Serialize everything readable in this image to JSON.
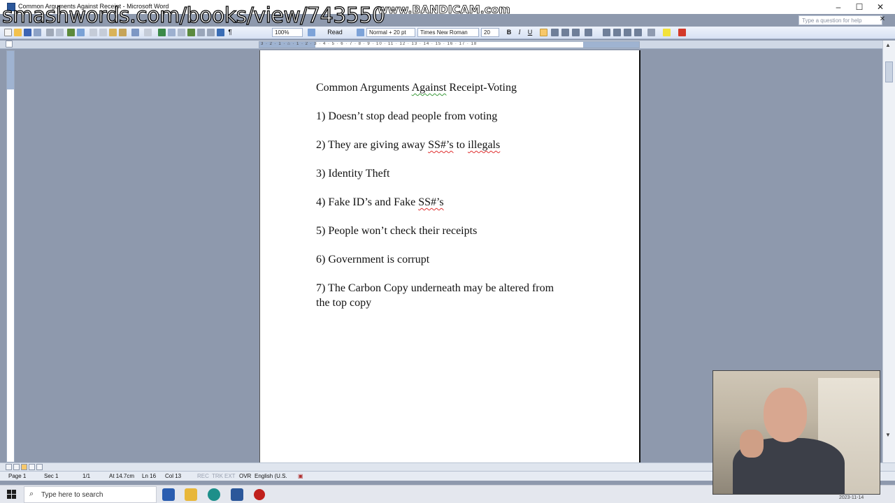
{
  "window": {
    "title": "Common Arguments Against Receipt - Microsoft Word",
    "help_placeholder": "Type a question for help",
    "minimize": "–",
    "maximize": "☐",
    "close": "✕",
    "doc_close": "✕"
  },
  "watermarks": {
    "url": "smashwords.com/books/view/743550",
    "recorder": "www.BANDICAM.com"
  },
  "toolbar": {
    "zoom": "100%",
    "read_label": "Read",
    "style": "Normal + 20 pt",
    "font": "Times New Roman",
    "size": "20",
    "bold": "B",
    "italic": "I",
    "underline": "U"
  },
  "ruler": {
    "ticks": "3 · 2 · 1 · ⌂ · 1 · 2 · 3 · 4 · 5 · 6 · 7 · 8 · 9 · 10 · 11 · 12 · 13 · 14 · 15 · 16 · 17 · 18"
  },
  "document": {
    "heading_prefix": "Common Arguments ",
    "heading_flag": "Against",
    "heading_suffix": " Receipt-Voting",
    "item1": "1) Doesn’t stop dead people from voting",
    "item2_a": "2) They are giving away ",
    "item2_b": "SS#’s",
    "item2_c": " to ",
    "item2_d": "illegals",
    "item3": "3) Identity Theft",
    "item4_a": "4) Fake ID’s and Fake ",
    "item4_b": "SS#’s",
    "item5": "5) People won’t check their receipts",
    "item6": "6) Government is corrupt",
    "item7_line1": "7) The Carbon Copy underneath may be altered from",
    "item7_line2": "the top copy"
  },
  "status": {
    "page": "Page 1",
    "sec": "Sec 1",
    "pages": "1/1",
    "at": "At 14.7cm",
    "ln": "Ln 16",
    "col": "Col 13",
    "rec": "REC",
    "trk": "TRK",
    "ext": "EXT",
    "ovr": "OVR",
    "lang": "English (U.S."
  },
  "taskbar": {
    "search_placeholder": "Type here to search",
    "date": "2023-11-14"
  },
  "colors": {
    "workspace": "#8e99ad",
    "toolbar": "#d7e2f3",
    "active_align": "#f7c86a",
    "spell_error": "#e03030"
  }
}
